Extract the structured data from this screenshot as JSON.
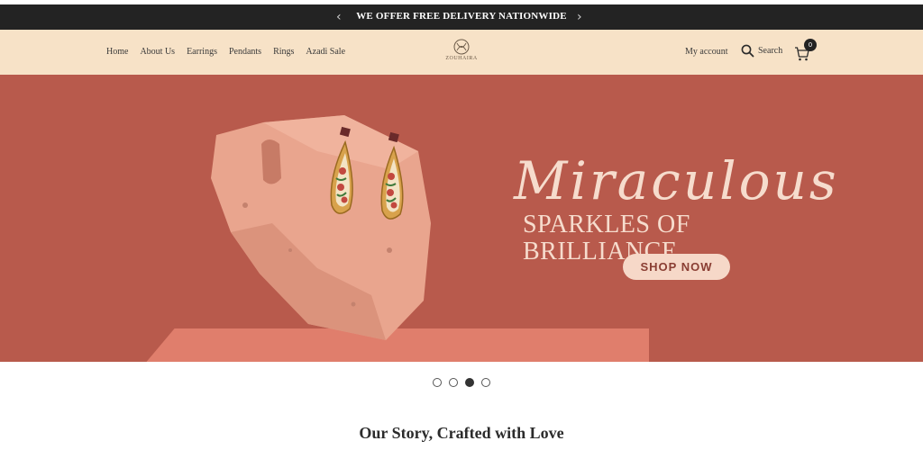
{
  "announcement": {
    "text": "WE OFFER FREE DELIVERY NATIONWIDE",
    "prev_icon": "chevron-left-icon",
    "next_icon": "chevron-right-icon"
  },
  "nav": {
    "items": [
      "Home",
      "About Us",
      "Earrings",
      "Pendants",
      "Rings",
      "Azadi Sale"
    ]
  },
  "brand": {
    "name": "ZOUHAIRA"
  },
  "header": {
    "account_label": "My account",
    "search_label": "Search",
    "cart_count": "0"
  },
  "hero": {
    "script": "Miraculous",
    "tagline": "SPARKLES OF BRILLIANCE",
    "cta": "SHOP NOW"
  },
  "carousel": {
    "slides": 4,
    "active_index": 2
  },
  "section": {
    "heading": "Our Story, Crafted with Love"
  },
  "colors": {
    "announcement_bg": "#232323",
    "header_bg": "#f7e2c7",
    "hero_bg": "#b85a4c",
    "cta_bg": "#f6d8c8"
  }
}
